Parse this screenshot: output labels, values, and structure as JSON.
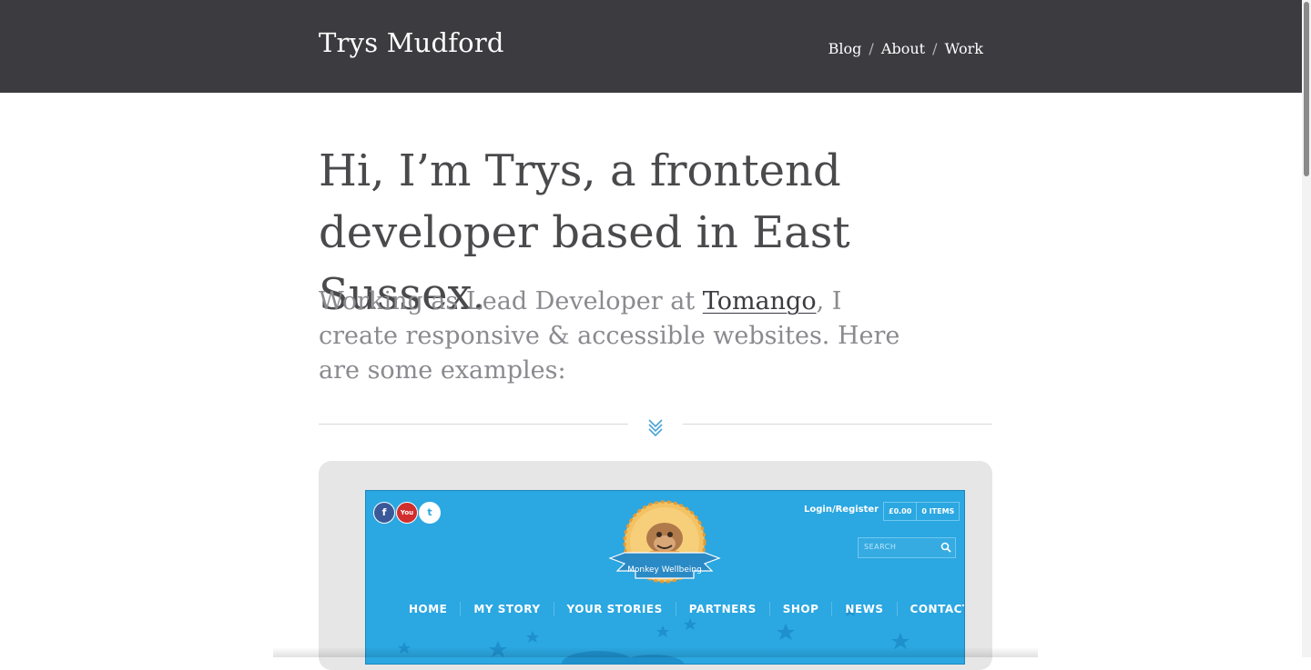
{
  "header": {
    "site_title": "Trys Mudford",
    "nav": {
      "blog": "Blog",
      "about": "About",
      "work": "Work",
      "separator": "/"
    }
  },
  "hero": {
    "intro": "Hi, I’m Trys, a frontend developer based in East Sussex.",
    "lead_before": "Working as Lead Developer at ",
    "lead_link": "Tomango",
    "lead_after": ", I create responsive & accessible websites. Here are some examples:"
  },
  "divider": {
    "icon": "double-chevron-down-icon",
    "color": "#4aa3d8"
  },
  "showcase": {
    "preview": {
      "social": [
        "f",
        "You",
        "t"
      ],
      "login": "Login/Register",
      "cart_total": "£0.00",
      "cart_items": "0 ITEMS",
      "search_placeholder": "SEARCH",
      "logo_text": "Monkey Wellbeing",
      "nav": [
        "HOME",
        "MY STORY",
        "YOUR STORIES",
        "PARTNERS",
        "SHOP",
        "NEWS",
        "CONTACT"
      ],
      "background": "#2ba7e1"
    }
  },
  "colors": {
    "header_bg": "#3b3b40",
    "heading_text": "#4a4a4d",
    "lead_text": "#8a8a8f"
  }
}
